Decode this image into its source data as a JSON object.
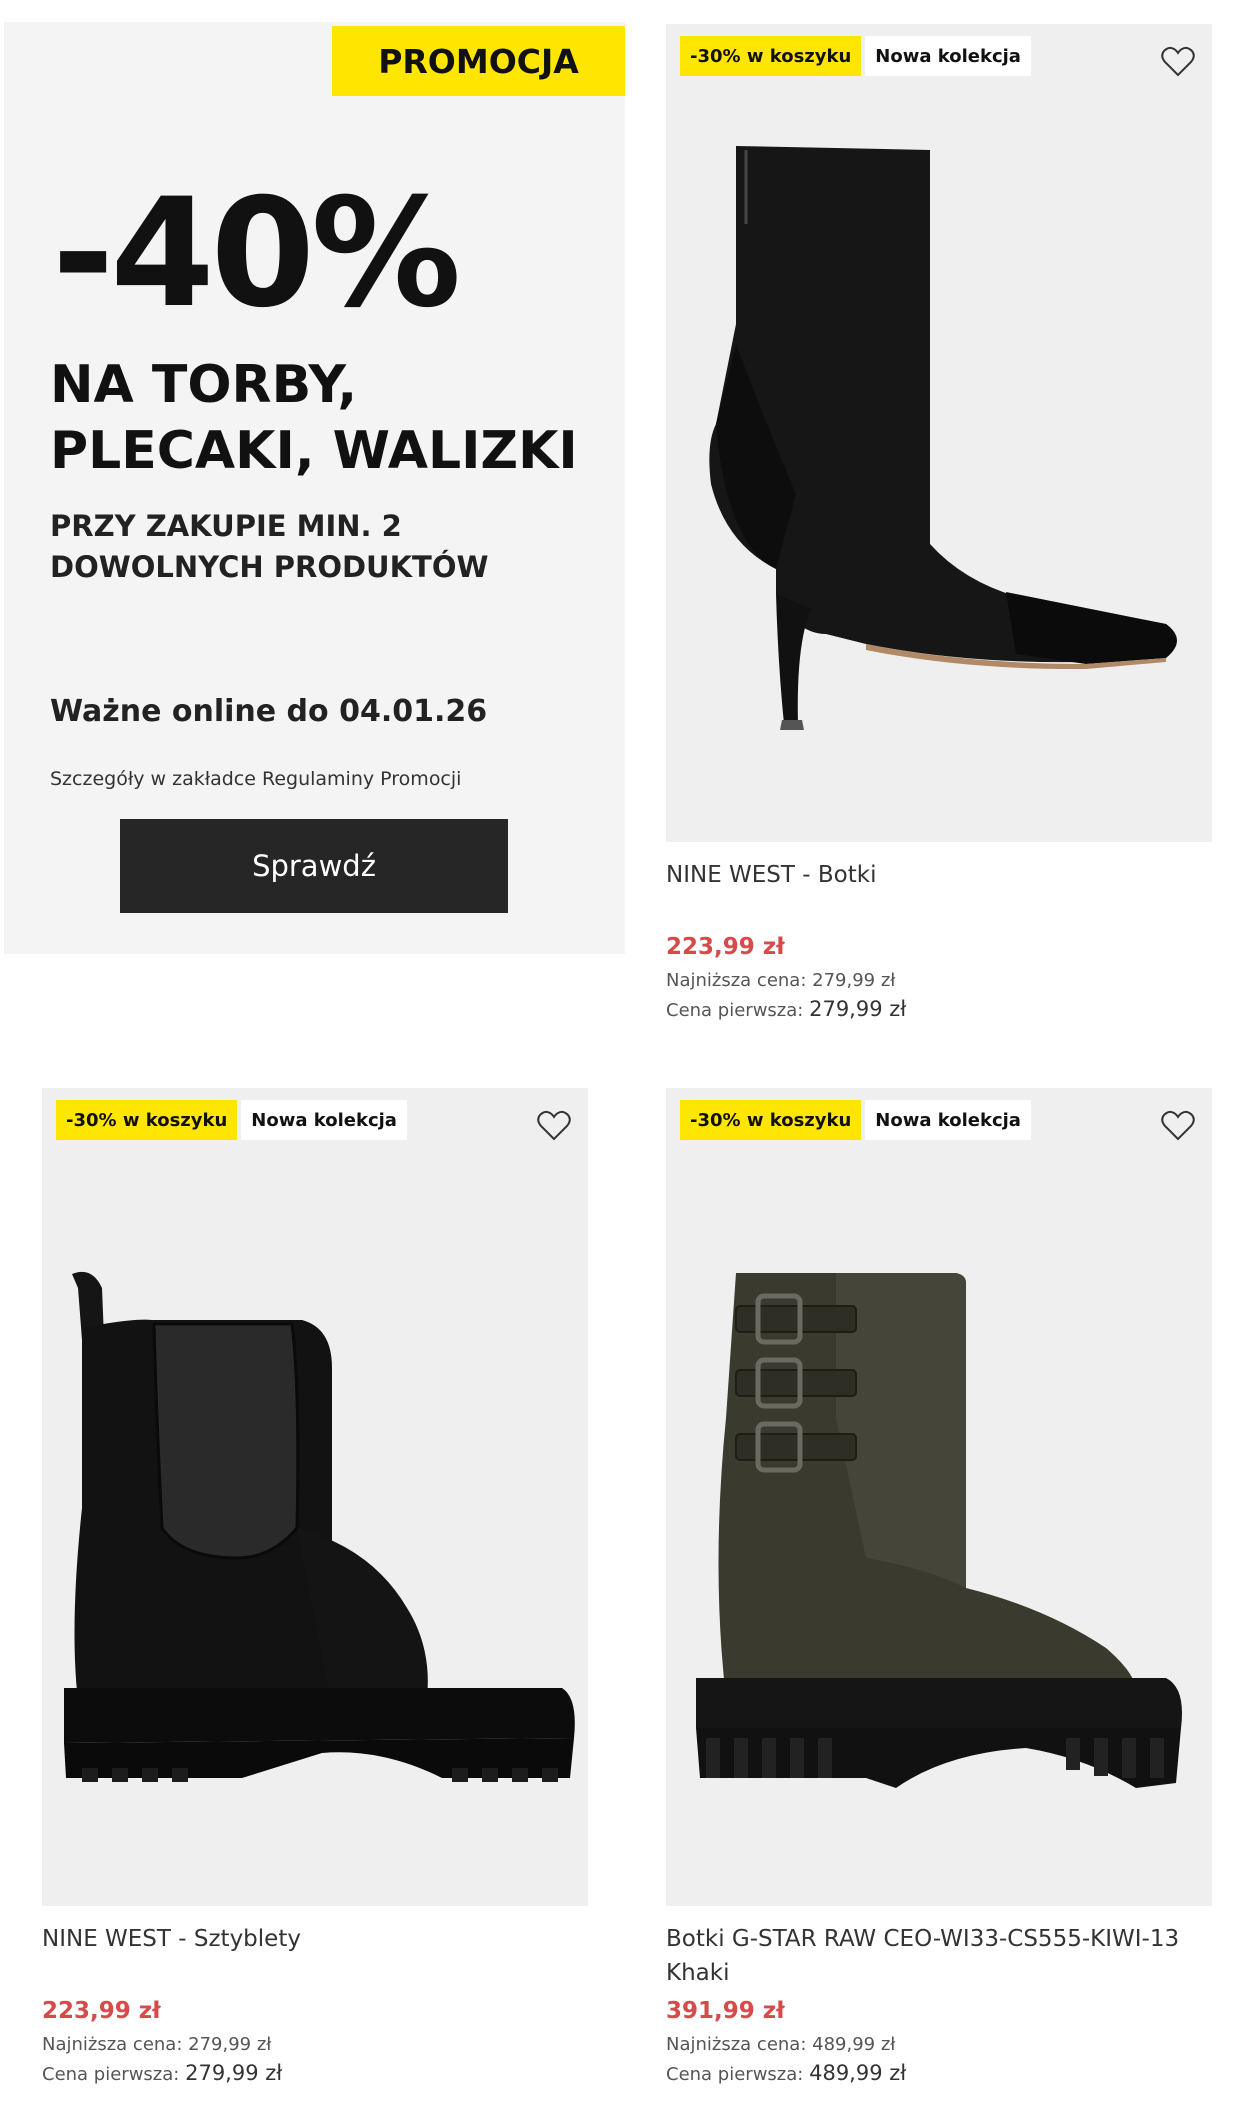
{
  "promo": {
    "tag": "PROMOCJA",
    "discount": "-40%",
    "headline_line1": "NA TORBY,",
    "headline_line2": "PLECAKI, WALIZKI",
    "subline": "PRZY ZAKUPIE MIN. 2 DOWOLNYCH PRODUKTÓW",
    "validity": "Ważne online do 04.01.26",
    "details": "Szczegóły w zakładce Regulaminy Promocji",
    "button_label": "Sprawdź",
    "colors": {
      "tag_bg": "#ffe600",
      "button_bg": "#262626",
      "panel_bg": "#f4f4f4"
    }
  },
  "products": [
    {
      "badge_discount": "-30% w koszyku",
      "badge_new": "Nowa kolekcja",
      "title": "NINE WEST - Botki",
      "price": "223,99 zł",
      "lowest_label": "Najniższa cena:",
      "lowest_value": "279,99 zł",
      "first_label": "Cena pierwsza:",
      "first_value": "279,99 zł",
      "image_icon": "heeled-ankle-boot-image"
    },
    {
      "badge_discount": "-30% w koszyku",
      "badge_new": "Nowa kolekcja",
      "title": "NINE WEST - Sztyblety",
      "price": "223,99 zł",
      "lowest_label": "Najniższa cena:",
      "lowest_value": "279,99 zł",
      "first_label": "Cena pierwsza:",
      "first_value": "279,99 zł",
      "image_icon": "chelsea-boot-image"
    },
    {
      "badge_discount": "-30% w koszyku",
      "badge_new": "Nowa kolekcja",
      "title": "Botki G-STAR RAW CEO-WI33-CS555-KIWI-13 Khaki",
      "price": "391,99 zł",
      "lowest_label": "Najniższa cena:",
      "lowest_value": "489,99 zł",
      "first_label": "Cena pierwsza:",
      "first_value": "489,99 zł",
      "image_icon": "buckle-boot-image"
    }
  ],
  "colors": {
    "price": "#d64a4a",
    "badge_yellow": "#ffe600",
    "card_bg": "#efefef"
  },
  "icons": {
    "wishlist": "heart-outline-icon"
  }
}
